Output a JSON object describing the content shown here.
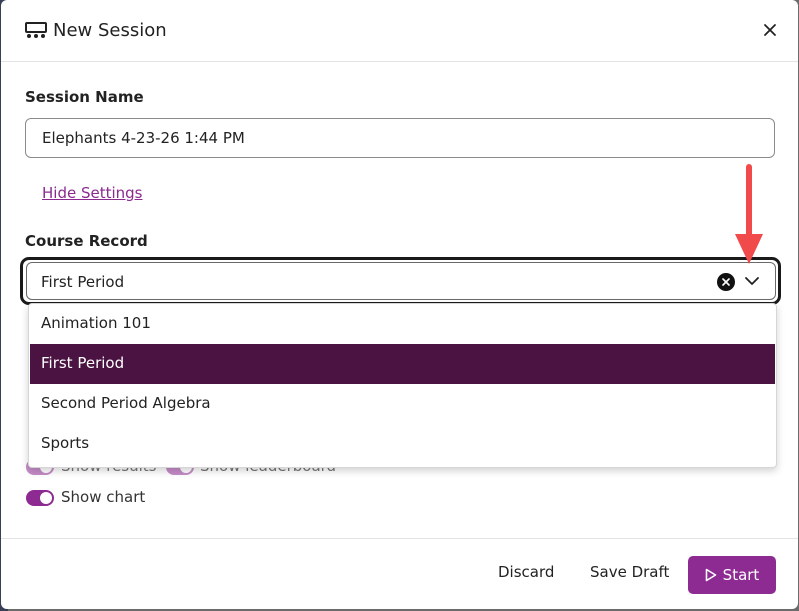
{
  "dialog": {
    "title": "New Session",
    "icon": "presentation-audience-icon",
    "close_icon": "close-icon"
  },
  "session_name": {
    "label": "Session Name",
    "value": "Elephants 4-23-26 1:44 PM"
  },
  "settings_link": "Hide Settings",
  "course_record": {
    "label": "Course Record",
    "selected": "First Period",
    "options": [
      "Animation 101",
      "First Period",
      "Second Period Algebra",
      "Sports"
    ]
  },
  "toggles": {
    "show_results": "Show results",
    "show_leaderboard": "Show leaderboard",
    "show_chart": "Show chart"
  },
  "footer": {
    "discard": "Discard",
    "save_draft": "Save Draft",
    "start": "Start"
  },
  "colors": {
    "accent": "#8e2b93",
    "selected_option": "#4a1342",
    "annotation_arrow": "#f04a4a"
  }
}
